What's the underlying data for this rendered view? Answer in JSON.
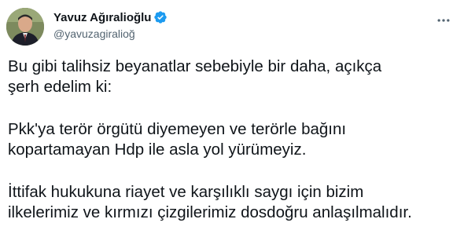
{
  "author": {
    "display_name": "Yavuz Ağıralioğlu",
    "handle": "@yavuzagiralioğ",
    "verified": true
  },
  "icons": {
    "verified": "verified-badge-icon",
    "more": "more-horizontal-icon"
  },
  "colors": {
    "verified_blue": "#1d9bf0",
    "text_primary": "#0f1419",
    "text_secondary": "#536471"
  },
  "tweet": {
    "paragraphs": [
      {
        "lines": [
          "Bu gibi talihsiz beyanatlar sebebiyle bir daha, açıkça",
          "şerh edelim ki:"
        ]
      },
      {
        "lines": [
          "Pkk'ya terör örgütü diyemeyen ve terörle bağını",
          "kopartamayan Hdp ile asla yol yürümeyiz."
        ]
      },
      {
        "lines": [
          "İttifak hukukuna riayet ve karşılıklı saygı için bizim",
          "ilkelerimiz ve kırmızı çizgilerimiz dosdoğru anlaşılmalıdır."
        ]
      }
    ]
  }
}
